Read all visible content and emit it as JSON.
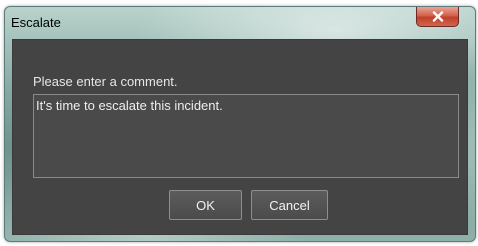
{
  "window": {
    "title": "Escalate",
    "close_icon": "close-icon"
  },
  "dialog": {
    "prompt": "Please enter a comment.",
    "comment_value": "It's time to escalate this incident."
  },
  "buttons": {
    "ok_label": "OK",
    "cancel_label": "Cancel"
  },
  "colors": {
    "panel_background": "#444444",
    "close_button": "#c7462f",
    "text": "#e6e6e6"
  }
}
